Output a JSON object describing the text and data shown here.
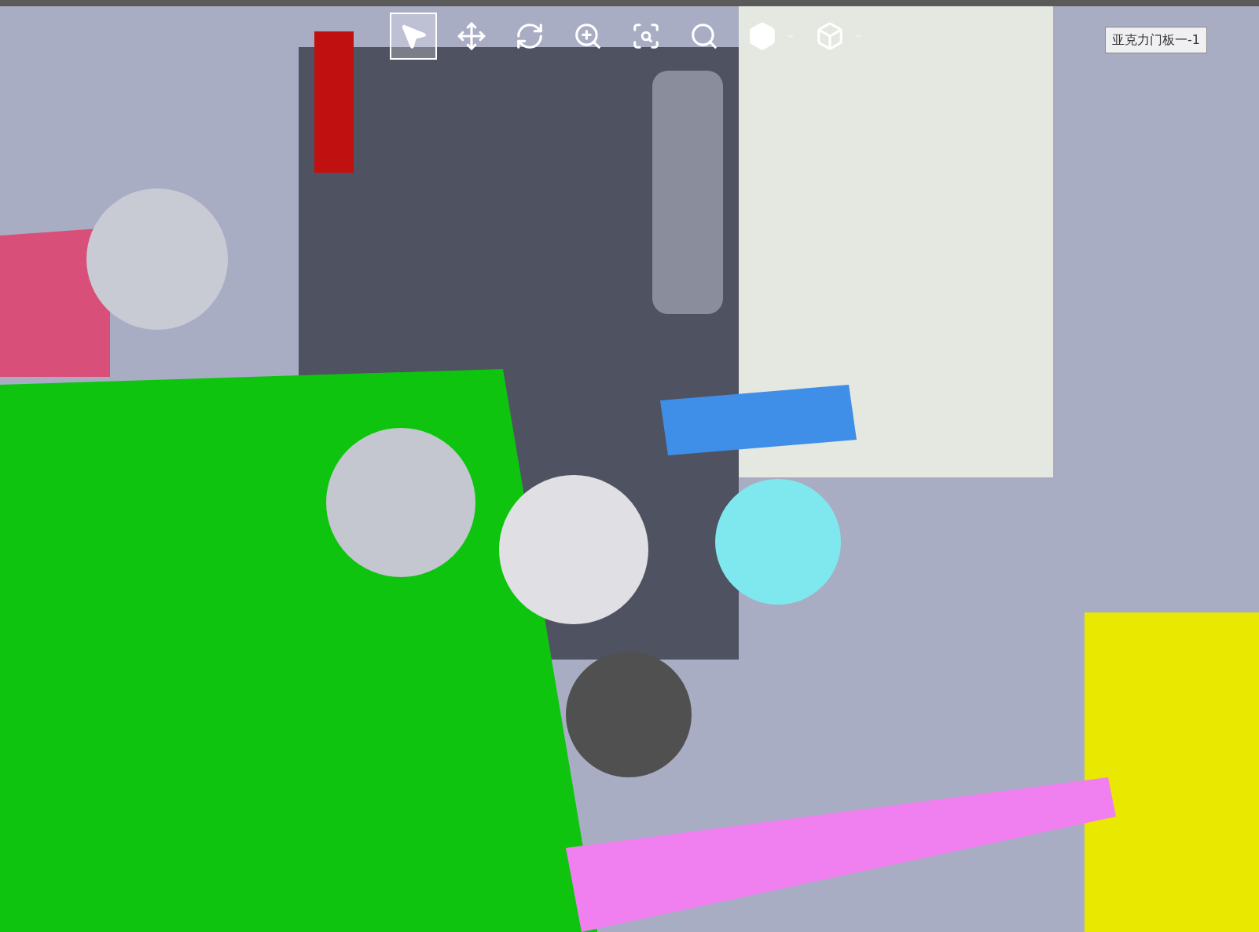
{
  "toolbar": {
    "tools": [
      {
        "kind": "select",
        "selected": true,
        "has_menu": false
      },
      {
        "kind": "pan",
        "selected": false,
        "has_menu": false
      },
      {
        "kind": "rotate",
        "selected": false,
        "has_menu": false
      },
      {
        "kind": "zoom",
        "selected": false,
        "has_menu": false
      },
      {
        "kind": "zoom-area",
        "selected": false,
        "has_menu": false
      },
      {
        "kind": "zoom-fit",
        "selected": false,
        "has_menu": false
      },
      {
        "kind": "display-style",
        "selected": false,
        "has_menu": true
      },
      {
        "kind": "view-orientation",
        "selected": false,
        "has_menu": true
      }
    ]
  },
  "component_label": "亚克力门板一-1"
}
